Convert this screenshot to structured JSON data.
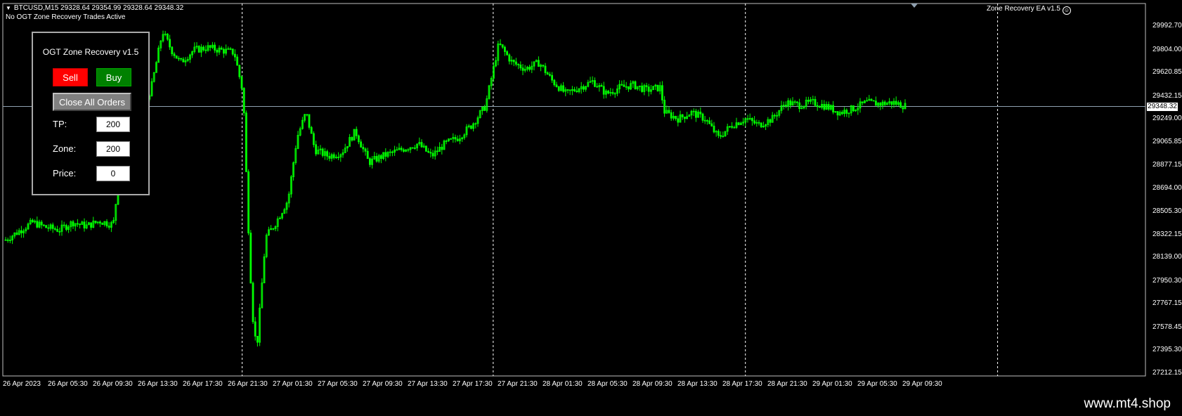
{
  "chart": {
    "symbol_line": "BTCUSD,M15  29328.64 29354.99 29328.64 29348.32",
    "status_line": "No OGT Zone Recovery Trades Active",
    "ea_label": "Zone Recovery EA  v1.5",
    "current_price": "29348.32",
    "y_labels": [
      "29992.70",
      "29804.00",
      "29620.85",
      "29432.15",
      "29249.00",
      "29065.85",
      "28877.15",
      "28694.00",
      "28505.30",
      "28322.15",
      "28139.00",
      "27950.30",
      "27767.15",
      "27578.45",
      "27395.30",
      "27212.15"
    ],
    "x_labels": [
      "26 Apr 2023",
      "26 Apr 05:30",
      "26 Apr 09:30",
      "26 Apr 13:30",
      "26 Apr 17:30",
      "26 Apr 21:30",
      "27 Apr 01:30",
      "27 Apr 05:30",
      "27 Apr 09:30",
      "27 Apr 13:30",
      "27 Apr 17:30",
      "27 Apr 21:30",
      "28 Apr 01:30",
      "28 Apr 05:30",
      "28 Apr 09:30",
      "28 Apr 13:30",
      "28 Apr 17:30",
      "28 Apr 21:30",
      "29 Apr 01:30",
      "29 Apr 05:30",
      "29 Apr 09:30"
    ],
    "colors": {
      "background": "#000000",
      "candle": "#00ff00",
      "grid": "#ffffff",
      "price_line": "#8fa0b0"
    },
    "price_series": [
      {
        "t": 0,
        "p": 28280
      },
      {
        "t": 0.06,
        "p": 28350
      },
      {
        "t": 0.12,
        "p": 28420
      },
      {
        "t": 0.18,
        "p": 28380
      },
      {
        "t": 0.24,
        "p": 28360
      },
      {
        "t": 0.3,
        "p": 28420
      },
      {
        "t": 0.36,
        "p": 28390
      },
      {
        "t": 0.42,
        "p": 28430
      },
      {
        "t": 0.48,
        "p": 28400
      },
      {
        "t": 0.5,
        "p": 28700
      },
      {
        "t": 0.55,
        "p": 28900
      },
      {
        "t": 0.6,
        "p": 29250
      },
      {
        "t": 0.65,
        "p": 29500
      },
      {
        "t": 0.7,
        "p": 29950
      },
      {
        "t": 0.74,
        "p": 29800
      },
      {
        "t": 0.78,
        "p": 29700
      },
      {
        "t": 0.84,
        "p": 29800
      },
      {
        "t": 0.9,
        "p": 29820
      },
      {
        "t": 0.96,
        "p": 29800
      },
      {
        "t": 1.02,
        "p": 29780
      },
      {
        "t": 1.06,
        "p": 29450
      },
      {
        "t": 1.08,
        "p": 28500
      },
      {
        "t": 1.1,
        "p": 27700
      },
      {
        "t": 1.12,
        "p": 27400
      },
      {
        "t": 1.16,
        "p": 28300
      },
      {
        "t": 1.2,
        "p": 28400
      },
      {
        "t": 1.26,
        "p": 28600
      },
      {
        "t": 1.3,
        "p": 29100
      },
      {
        "t": 1.34,
        "p": 29300
      },
      {
        "t": 1.38,
        "p": 29000
      },
      {
        "t": 1.44,
        "p": 28950
      },
      {
        "t": 1.5,
        "p": 28980
      },
      {
        "t": 1.56,
        "p": 29150
      },
      {
        "t": 1.62,
        "p": 28900
      },
      {
        "t": 1.68,
        "p": 28950
      },
      {
        "t": 1.76,
        "p": 29000
      },
      {
        "t": 1.84,
        "p": 29050
      },
      {
        "t": 1.9,
        "p": 28950
      },
      {
        "t": 1.96,
        "p": 29050
      },
      {
        "t": 2.02,
        "p": 29100
      },
      {
        "t": 2.08,
        "p": 29200
      },
      {
        "t": 2.14,
        "p": 29350
      },
      {
        "t": 2.2,
        "p": 29850
      },
      {
        "t": 2.26,
        "p": 29700
      },
      {
        "t": 2.32,
        "p": 29650
      },
      {
        "t": 2.38,
        "p": 29700
      },
      {
        "t": 2.44,
        "p": 29550
      },
      {
        "t": 2.5,
        "p": 29450
      },
      {
        "t": 2.56,
        "p": 29500
      },
      {
        "t": 2.62,
        "p": 29550
      },
      {
        "t": 2.68,
        "p": 29450
      },
      {
        "t": 2.74,
        "p": 29500
      },
      {
        "t": 2.8,
        "p": 29520
      },
      {
        "t": 2.86,
        "p": 29480
      },
      {
        "t": 2.92,
        "p": 29500
      },
      {
        "t": 2.94,
        "p": 29300
      },
      {
        "t": 3.0,
        "p": 29250
      },
      {
        "t": 3.06,
        "p": 29300
      },
      {
        "t": 3.12,
        "p": 29250
      },
      {
        "t": 3.18,
        "p": 29100
      },
      {
        "t": 3.24,
        "p": 29200
      },
      {
        "t": 3.3,
        "p": 29250
      },
      {
        "t": 3.36,
        "p": 29200
      },
      {
        "t": 3.42,
        "p": 29250
      },
      {
        "t": 3.48,
        "p": 29380
      },
      {
        "t": 3.54,
        "p": 29360
      },
      {
        "t": 3.6,
        "p": 29380
      },
      {
        "t": 3.66,
        "p": 29350
      },
      {
        "t": 3.72,
        "p": 29300
      },
      {
        "t": 3.78,
        "p": 29330
      },
      {
        "t": 3.84,
        "p": 29380
      },
      {
        "t": 3.9,
        "p": 29370
      },
      {
        "t": 3.96,
        "p": 29380
      },
      {
        "t": 4.02,
        "p": 29348
      }
    ]
  },
  "panel": {
    "title": "OGT Zone Recovery v1.5",
    "sell_label": "Sell",
    "buy_label": "Buy",
    "close_all_label": "Close All Orders",
    "tp_label": "TP:",
    "tp_value": "200",
    "zone_label": "Zone:",
    "zone_value": "200",
    "price_label": "Price:",
    "price_value": "0"
  },
  "watermark": "www.mt4.shop"
}
